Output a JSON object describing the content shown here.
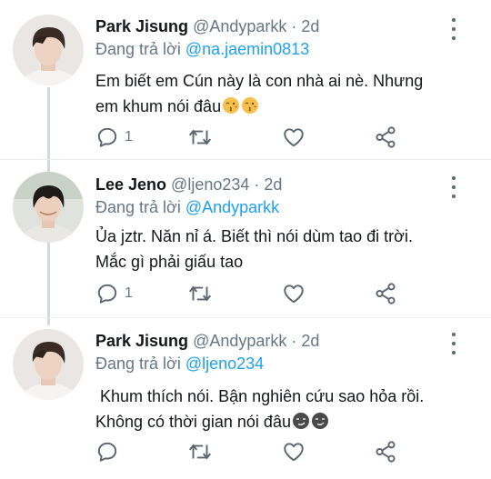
{
  "tweets": [
    {
      "name": "Park Jisung",
      "handle": "@Andyparkk",
      "dot": " · ",
      "time": "2d",
      "reply_prefix": "Đang trả lời ",
      "reply_to": "@na.jaemin0813",
      "text_line1": "Em biết em Cún này là con nhà ai nè. Nhưng",
      "text_line2": "em khum nói đâu",
      "emojis": [
        "kissing-heart-emoji",
        "kissing-heart-emoji"
      ],
      "reply_count": "1",
      "avatar": "park-jisung-avatar"
    },
    {
      "name": "Lee Jeno",
      "handle": "@ljeno234",
      "dot": " · ",
      "time": "2d",
      "reply_prefix": "Đang trả lời ",
      "reply_to": "@Andyparkk",
      "text_line1": "Ủa jztr. Năn nỉ á. Biết thì nói dùm tao đi trời.",
      "text_line2": "Mắc gì phải giấu tao",
      "reply_count": "1",
      "avatar": "lee-jeno-avatar"
    },
    {
      "name": "Park Jisung",
      "handle": "@Andyparkk",
      "dot": " · ",
      "time": "2d",
      "reply_prefix": "Đang trả lời ",
      "reply_to": "@ljeno234",
      "text_line1": " Khum thích nói. Bận nghiên cứu sao hỏa rồi.",
      "text_line2": "Không có thời gian nói đâu",
      "emojis": [
        "smirk-dark-emoji",
        "smirk-dark-emoji"
      ],
      "reply_count": "",
      "avatar": "park-jisung-avatar"
    }
  ],
  "icons": {
    "reply": "reply-icon",
    "retweet": "retweet-icon",
    "like": "heart-icon",
    "share": "share-icon",
    "more": "more-vertical-icon"
  },
  "colors": {
    "accent": "#1da1f2",
    "secondary_text": "#657786",
    "icon": "#5b6670",
    "thread_line": "#d3d9de"
  }
}
